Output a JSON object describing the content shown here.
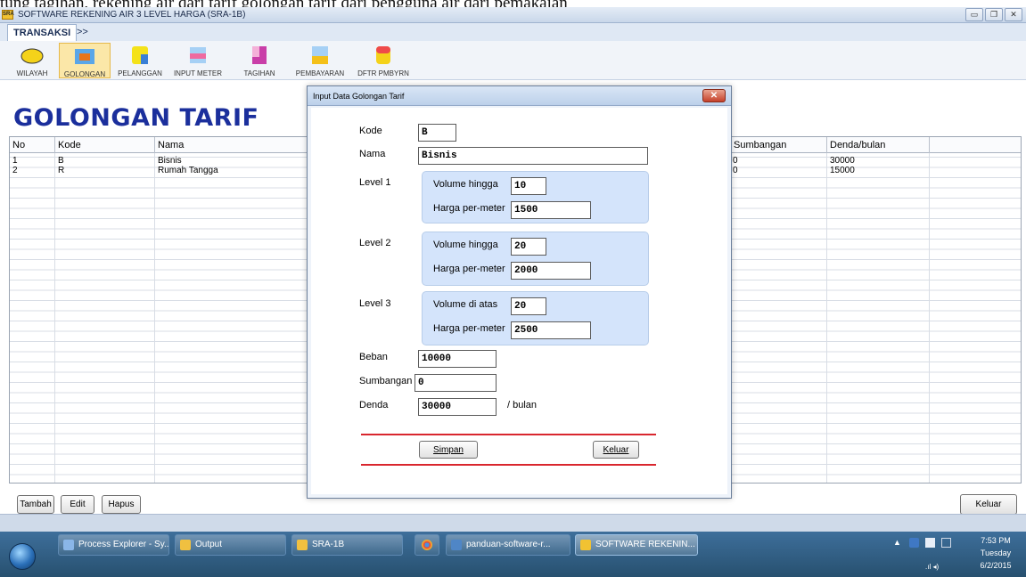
{
  "app": {
    "title": "SOFTWARE REKENING AIR 3 LEVEL HARGA (SRA-1B)",
    "icon_text": "SRA",
    "background_text": "tung tagihan, rekening air dari tarif golongan tarif dari pengguna air dari pemakaian"
  },
  "tabs": [
    {
      "label": "TRANSAKSI",
      "active": true
    },
    {
      "label": ">>",
      "active": false
    }
  ],
  "toolbar": [
    {
      "label": "WILAYAH",
      "icon": "wilayah-icon"
    },
    {
      "label": "GOLONGAN",
      "icon": "golongan-icon",
      "active": true
    },
    {
      "label": "PELANGGAN",
      "icon": "pelanggan-icon"
    },
    {
      "label": "INPUT METER",
      "icon": "input-meter-icon"
    },
    {
      "label": "TAGIHAN",
      "icon": "tagihan-icon"
    },
    {
      "label": "PEMBAYARAN",
      "icon": "pembayaran-icon"
    },
    {
      "label": "DFTR PMBYRN",
      "icon": "dftr-pmbyrn-icon"
    }
  ],
  "page_title": "GOLONGAN TARIF",
  "grid": {
    "columns": [
      "No",
      "Kode",
      "Nama",
      "Sumbangan",
      "Denda/bulan"
    ],
    "rows": [
      {
        "no": "1",
        "kode": "B",
        "nama": "Bisnis",
        "sumbangan": "0",
        "denda": "30000"
      },
      {
        "no": "2",
        "kode": "R",
        "nama": "Rumah Tangga",
        "sumbangan": "0",
        "denda": "15000"
      }
    ]
  },
  "buttons": {
    "tambah": "Tambah",
    "edit": "Edit",
    "hapus": "Hapus",
    "keluar": "Keluar"
  },
  "dialog": {
    "title": "Input Data Golongan Tarif",
    "kode_label": "Kode",
    "kode_value": "B",
    "nama_label": "Nama",
    "nama_value": "Bisnis",
    "levels": [
      {
        "label": "Level 1",
        "volume_label": "Volume hingga",
        "volume": "10",
        "harga_label": "Harga per-meter",
        "harga": "1500"
      },
      {
        "label": "Level 2",
        "volume_label": "Volume hingga",
        "volume": "20",
        "harga_label": "Harga per-meter",
        "harga": "2000"
      },
      {
        "label": "Level 3",
        "volume_label": "Volume di atas",
        "volume": "20",
        "harga_label": "Harga per-meter",
        "harga": "2500"
      }
    ],
    "beban_label": "Beban",
    "beban_value": "10000",
    "sumbangan_label": "Sumbangan",
    "sumbangan_value": "0",
    "denda_label": "Denda",
    "denda_value": "30000",
    "denda_suffix": "/ bulan",
    "simpan": "Simpan",
    "keluar": "Keluar"
  },
  "taskbar": {
    "items": [
      {
        "label": "Process Explorer - Sy...",
        "color": "#8ab6e8"
      },
      {
        "label": "Output",
        "color": "#f0c040"
      },
      {
        "label": "SRA-1B",
        "color": "#f0c040"
      },
      {
        "label": "panduan-software-r...",
        "color": "#4f86c6"
      },
      {
        "label": "SOFTWARE REKENIN...",
        "color": "#f1c232"
      }
    ],
    "time": "7:53 PM",
    "day": "Tuesday",
    "date": "6/2/2015"
  },
  "colors": {
    "title_blue": "#1b2f9c",
    "accent_red": "#d9262e",
    "level_panel": "#d4e4fb"
  }
}
